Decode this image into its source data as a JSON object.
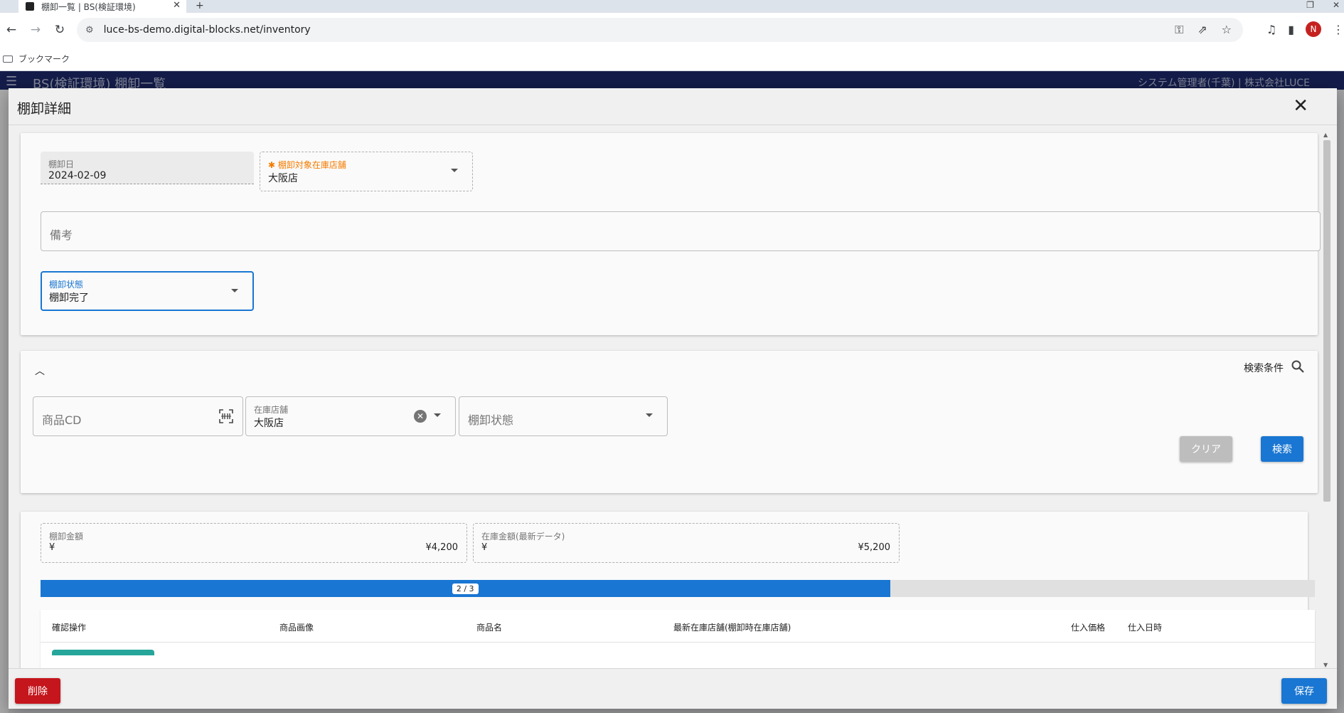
{
  "browser": {
    "tab_title": "棚卸一覧 | BS(検証環境)",
    "url": "luce-bs-demo.digital-blocks.net/inventory",
    "bookmarks_label": "ブックマーク",
    "profile_initial": "N"
  },
  "app": {
    "title": "BS(検証環境) 棚卸一覧",
    "user": "システム管理者(千葉) | 株式会社LUCE"
  },
  "dialog": {
    "title": "棚卸詳細",
    "form": {
      "date_label": "棚卸日",
      "date_value": "2024-02-09",
      "store_label": "棚卸対象在庫店舗",
      "store_value": "大阪店",
      "note_placeholder": "備考",
      "status_label": "棚卸状態",
      "status_value": "棚卸完了"
    },
    "search": {
      "condition_label": "検索条件",
      "product_cd_placeholder": "商品CD",
      "store_label": "在庫店舗",
      "store_value": "大阪店",
      "status_placeholder": "棚卸状態",
      "clear_label": "クリア",
      "search_label": "検索"
    },
    "summary": {
      "inventory_amount_label": "棚卸金額",
      "inventory_amount_currency": "¥",
      "inventory_amount_value": "¥4,200",
      "stock_amount_label": "在庫金額(最新データ)",
      "stock_amount_currency": "¥",
      "stock_amount_value": "¥5,200"
    },
    "progress": {
      "label": "2 / 3",
      "done": 2,
      "total": 3
    },
    "table": {
      "headers": [
        "確認操作",
        "商品画像",
        "商品名",
        "最新在庫店舗(棚卸時在庫店舗)",
        "仕入価格",
        "仕入日時"
      ]
    },
    "footer": {
      "delete_label": "削除",
      "save_label": "保存"
    }
  },
  "colors": {
    "primary": "#1976d2",
    "danger": "#c4161c",
    "required": "#f57c00",
    "appbar": "#1e2a6b"
  }
}
